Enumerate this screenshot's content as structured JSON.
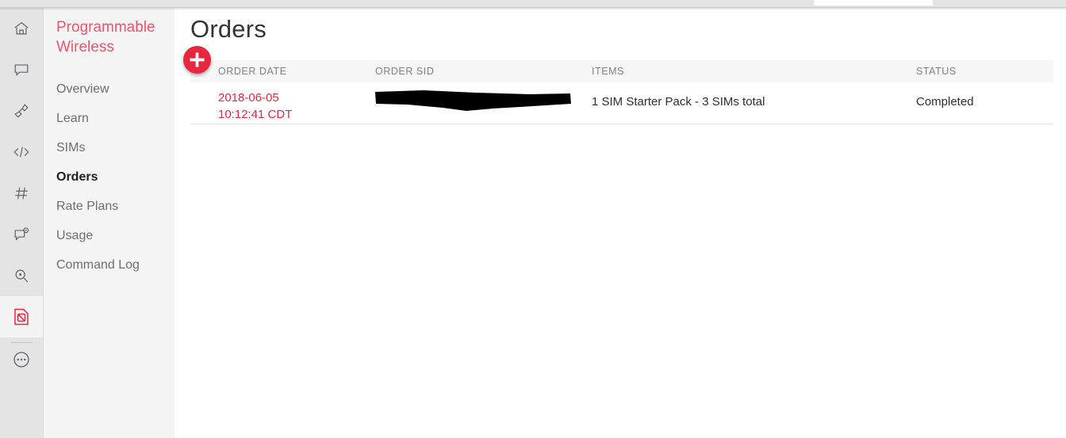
{
  "browser": {
    "address_field_value": ""
  },
  "icon_rail": {
    "items": [
      {
        "name": "home-icon",
        "label": "Home"
      },
      {
        "name": "messaging-icon",
        "label": "Programmable SMS"
      },
      {
        "name": "voice-phone-icon",
        "label": "Programmable Voice"
      },
      {
        "name": "code-icon",
        "label": "Runtime"
      },
      {
        "name": "hash-icon",
        "label": "Phone Numbers"
      },
      {
        "name": "chat-icon",
        "label": "Programmable Chat"
      },
      {
        "name": "lookup-icon",
        "label": "Lookup"
      },
      {
        "name": "sim-card-icon",
        "label": "Programmable Wireless"
      },
      {
        "name": "more-icon",
        "label": "All Products & Services"
      }
    ],
    "active_index": 7
  },
  "sidebar": {
    "product_title": "Programmable Wireless",
    "items": [
      {
        "label": "Overview",
        "active": false
      },
      {
        "label": "Learn",
        "active": false
      },
      {
        "label": "SIMs",
        "active": false
      },
      {
        "label": "Orders",
        "active": true
      },
      {
        "label": "Rate Plans",
        "active": false
      },
      {
        "label": "Usage",
        "active": false
      },
      {
        "label": "Command Log",
        "active": false
      }
    ]
  },
  "main": {
    "page_title": "Orders",
    "add_button_label": "+",
    "table": {
      "columns": [
        "ORDER DATE",
        "ORDER SID",
        "ITEMS",
        "STATUS"
      ],
      "rows": [
        {
          "order_date_line1": "2018-06-05",
          "order_date_line2": "10:12:41 CDT",
          "order_sid": "",
          "order_sid_redacted": true,
          "items": "1 SIM Starter Pack - 3 SIMs total",
          "status": "Completed"
        }
      ]
    }
  },
  "colors": {
    "brand_red": "#e8283f",
    "product_title_red": "#f2536d",
    "rail_bg": "#e4e4e4",
    "nav_bg": "#f4f4f4",
    "table_header_bg": "#f6f6f6",
    "text_dark": "#2e2e33",
    "text_muted": "#808089"
  }
}
